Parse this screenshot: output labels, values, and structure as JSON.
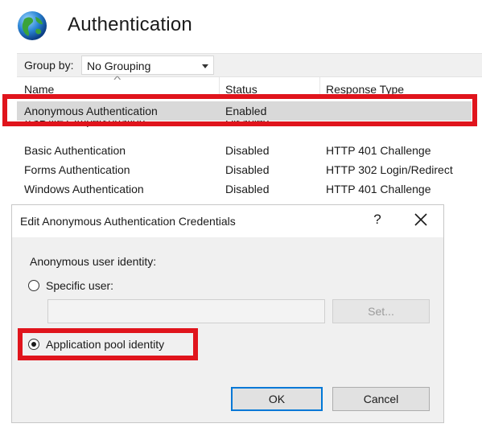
{
  "header": {
    "title": "Authentication",
    "icon": "globe-icon"
  },
  "toolbar": {
    "group_by_label": "Group by:",
    "group_by_value": "No Grouping",
    "sort_indicator": "^"
  },
  "table": {
    "columns": [
      "Name",
      "Status",
      "Response Type"
    ],
    "rows": [
      {
        "name": "Anonymous Authentication",
        "status": "Enabled",
        "response": ""
      },
      {
        "name": "ASP.NET Impersonation",
        "status": "Disabled",
        "response": ""
      },
      {
        "name": "Basic Authentication",
        "status": "Disabled",
        "response": "HTTP 401 Challenge"
      },
      {
        "name": "Forms Authentication",
        "status": "Disabled",
        "response": "HTTP 302 Login/Redirect"
      },
      {
        "name": "Windows Authentication",
        "status": "Disabled",
        "response": "HTTP 401 Challenge"
      }
    ],
    "selected_row": "Anonymous Authentication"
  },
  "dialog": {
    "title": "Edit Anonymous Authentication Credentials",
    "help_label": "?",
    "identity_label": "Anonymous user identity:",
    "specific_user_label": "Specific user:",
    "specific_user_value": "",
    "set_button": "Set...",
    "app_pool_label": "Application pool identity",
    "selected_option": "Application pool identity",
    "ok_button": "OK",
    "cancel_button": "Cancel"
  },
  "colors": {
    "highlight": "#e0141c",
    "selection": "#d9d9d9",
    "focus": "#0078d7",
    "toolbar_bg": "#f0f0f0"
  }
}
